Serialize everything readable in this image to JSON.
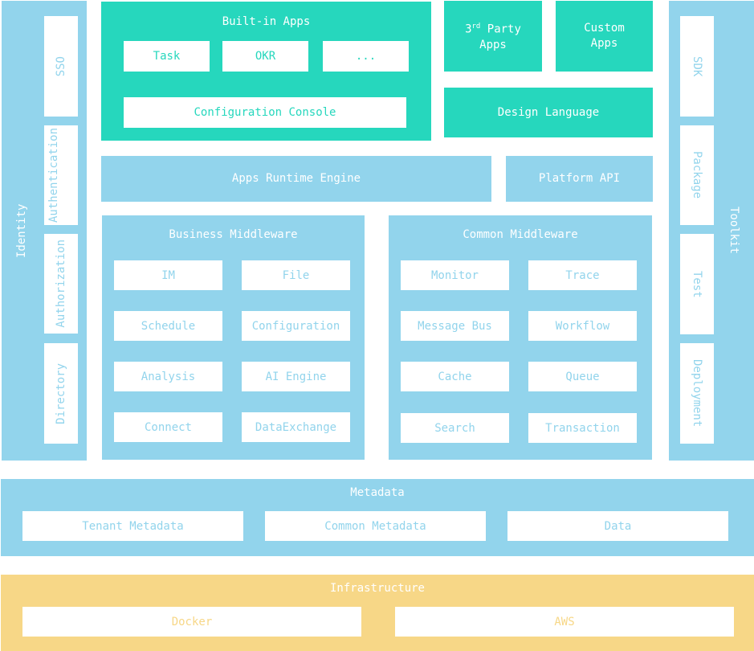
{
  "identity": {
    "label": "Identity",
    "items": [
      "SSO",
      "Authentication",
      "Authorization",
      "Directory"
    ]
  },
  "builtin_apps": {
    "title": "Built-in Apps",
    "apps": [
      "Task",
      "OKR",
      "..."
    ],
    "console": "Configuration Console"
  },
  "third_party": {
    "prefix": "3",
    "sup": "rd",
    "line1_rest": " Party",
    "line2": "Apps"
  },
  "custom_apps": {
    "line1": "Custom",
    "line2": "Apps"
  },
  "design_language": "Design Language",
  "apps_runtime_engine": "Apps Runtime Engine",
  "platform_api": "Platform API",
  "business_middleware": {
    "title": "Business Middleware",
    "items": [
      "IM",
      "File",
      "Schedule",
      "Configuration",
      "Analysis",
      "AI Engine",
      "Connect",
      "DataExchange"
    ]
  },
  "common_middleware": {
    "title": "Common Middleware",
    "items": [
      "Monitor",
      "Trace",
      "Message Bus",
      "Workflow",
      "Cache",
      "Queue",
      "Search",
      "Transaction"
    ]
  },
  "toolkit": {
    "label": "Toolkit",
    "items": [
      "SDK",
      "Package",
      "Test",
      "Deployment"
    ]
  },
  "metadata": {
    "title": "Metadata",
    "items": [
      "Tenant Metadata",
      "Common Metadata",
      "Data"
    ]
  },
  "infrastructure": {
    "title": "Infrastructure",
    "items": [
      "Docker",
      "AWS"
    ]
  },
  "colors": {
    "teal": "#26d7bd",
    "blue": "#92d4ec",
    "yellow": "#f7d787",
    "white": "#ffffff"
  }
}
